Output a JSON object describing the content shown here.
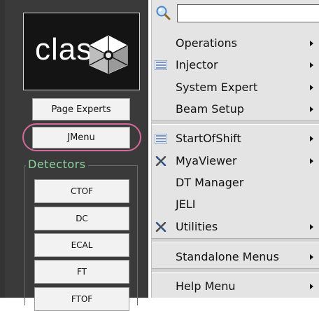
{
  "left_panel": {
    "logo_text": "clas",
    "buttons": {
      "page_experts": "Page Experts",
      "jmenu": "JMenu"
    },
    "detectors": {
      "title": "Detectors",
      "items": [
        "CTOF",
        "DC",
        "ECAL",
        "FT",
        "FTOF"
      ]
    }
  },
  "menu": {
    "search": {
      "value": "",
      "placeholder": ""
    },
    "items": [
      {
        "label": "Operations",
        "icon": "",
        "submenu": true
      },
      {
        "label": "Injector",
        "icon": "list-icon",
        "submenu": true
      },
      {
        "label": "System Expert",
        "icon": "",
        "submenu": true
      },
      {
        "label": "Beam Setup",
        "icon": "",
        "submenu": true
      },
      {
        "label": "StartOfShift",
        "icon": "list-icon",
        "submenu": true
      },
      {
        "label": "MyaViewer",
        "icon": "tools-icon",
        "submenu": true
      },
      {
        "label": "DT Manager",
        "icon": "",
        "submenu": false
      },
      {
        "label": "JELI",
        "icon": "",
        "submenu": false
      },
      {
        "label": "Utilities",
        "icon": "tools-icon",
        "submenu": true
      },
      {
        "label": "Standalone Menus",
        "icon": "",
        "submenu": true
      },
      {
        "label": "Help Menu",
        "icon": "",
        "submenu": true
      }
    ]
  },
  "colors": {
    "panel_bg": "#3a3a3a",
    "detectors_label": "#8ed5a0",
    "highlight_ring": "#d46a9c",
    "menu_bg": "#e4e4e4"
  }
}
